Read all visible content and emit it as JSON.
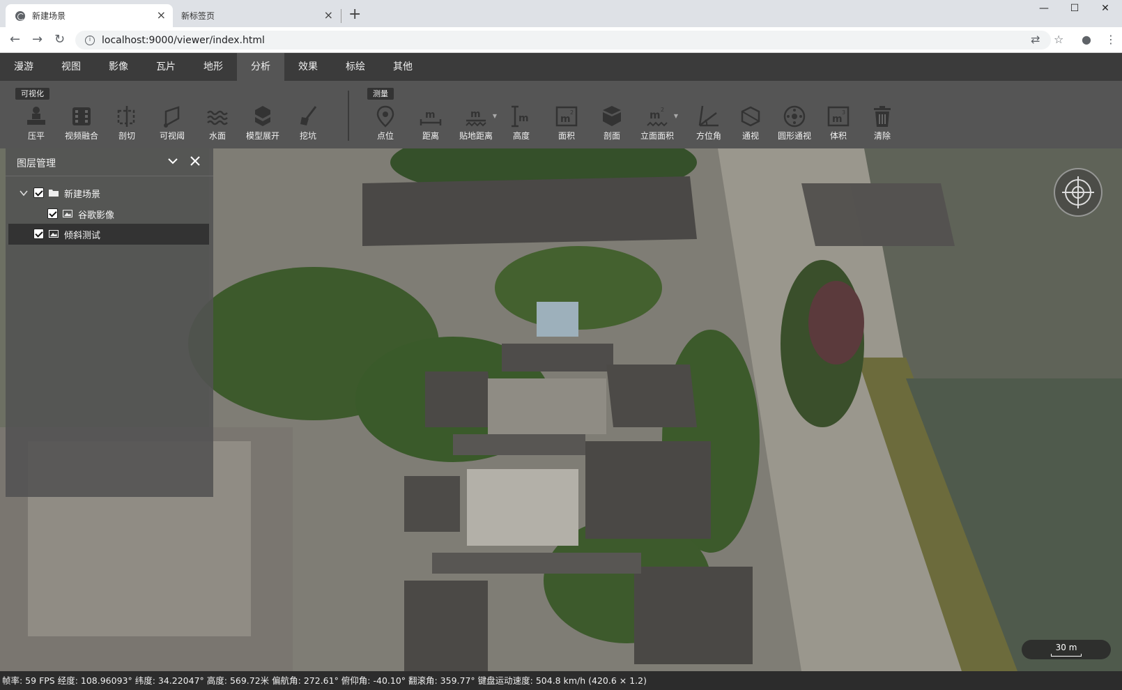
{
  "browser": {
    "tabs": [
      {
        "title": "新建场景",
        "active": true
      },
      {
        "title": "新标签页",
        "active": false
      }
    ],
    "url": "localhost:9000/viewer/index.html"
  },
  "menu": {
    "items": [
      "漫游",
      "视图",
      "影像",
      "瓦片",
      "地形",
      "分析",
      "效果",
      "标绘",
      "其他"
    ],
    "active": "分析"
  },
  "ribbon": {
    "groups": [
      {
        "label": "可视化",
        "tools": [
          {
            "label": "压平",
            "icon": "flatten-icon"
          },
          {
            "label": "视频融合",
            "icon": "video-fusion-icon"
          },
          {
            "label": "剖切",
            "icon": "section-cut-icon"
          },
          {
            "label": "可视阈",
            "icon": "viewshed-icon"
          },
          {
            "label": "水面",
            "icon": "water-surface-icon"
          },
          {
            "label": "模型展开",
            "icon": "model-unfold-icon"
          },
          {
            "label": "挖坑",
            "icon": "excavate-icon"
          }
        ]
      },
      {
        "label": "测量",
        "tools": [
          {
            "label": "点位",
            "icon": "point-location-icon"
          },
          {
            "label": "距离",
            "icon": "distance-icon"
          },
          {
            "label": "贴地距离",
            "icon": "ground-distance-icon"
          },
          {
            "label": "高度",
            "icon": "height-icon"
          },
          {
            "label": "面积",
            "icon": "area-icon"
          },
          {
            "label": "剖面",
            "icon": "profile-icon"
          },
          {
            "label": "立面面积",
            "icon": "facade-area-icon"
          },
          {
            "label": "方位角",
            "icon": "azimuth-icon"
          },
          {
            "label": "通视",
            "icon": "line-of-sight-icon"
          },
          {
            "label": "圆形通视",
            "icon": "circular-visibility-icon"
          },
          {
            "label": "体积",
            "icon": "volume-icon"
          },
          {
            "label": "清除",
            "icon": "trash-icon"
          }
        ]
      }
    ]
  },
  "layer_panel": {
    "title": "图层管理",
    "items": [
      {
        "label": "新建场景",
        "checked": true,
        "type": "folder"
      },
      {
        "label": "谷歌影像",
        "checked": true,
        "type": "imagery"
      },
      {
        "label": "倾斜测试",
        "checked": true,
        "type": "imagery"
      }
    ]
  },
  "scale": {
    "label": "30 m"
  },
  "status": {
    "text": "帧率: 59 FPS 经度: 108.96093° 纬度: 34.22047° 高度: 569.72米 偏航角: 272.61° 俯仰角: -40.10° 翻滚角: 359.77° 键盘运动速度: 504.8 km/h (420.6 × 1.2)"
  }
}
